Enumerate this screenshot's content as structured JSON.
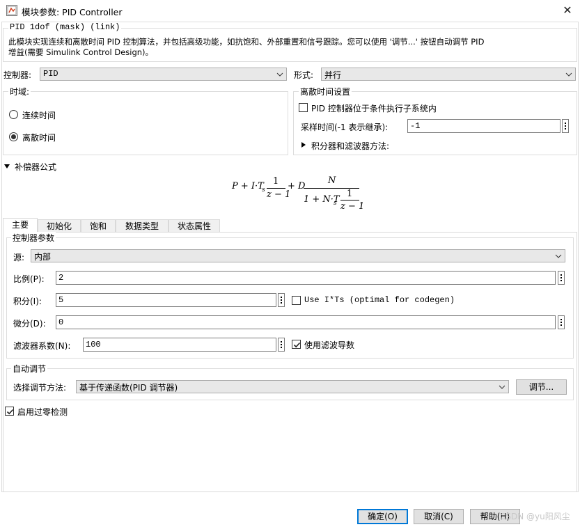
{
  "window": {
    "title": "模块参数: PID Controller"
  },
  "header": {
    "block_name": "PID 1dof (mask) (link)",
    "description_line1": "此模块实现连续和离散时间 PID 控制算法，并包括高级功能，如抗饱和、外部重置和信号跟踪。您可以使用 '调节...' 按钮自动调节 PID",
    "description_line2": "增益(需要 Simulink Control Design)。"
  },
  "controller": {
    "label": "控制器:",
    "value": "PID"
  },
  "form": {
    "label": "形式:",
    "value": "并行"
  },
  "time_domain": {
    "title": "时域:",
    "continuous_label": "连续时间",
    "discrete_label": "离散时间",
    "selected": "离散时间"
  },
  "discrete_settings": {
    "title": "离散时间设置",
    "conditional_label": "PID 控制器位于条件执行子系统内",
    "conditional_checked": false,
    "sample_time_label": "采样时间(-1 表示继承):",
    "sample_time_value": "-1",
    "integrator_methods_label": "积分器和滤波器方法:"
  },
  "compensator": {
    "label": "补偿器公式",
    "formula": {
      "lead": "P + I·T",
      "sub_s": "s",
      "num1": "1",
      "den1": "z − 1",
      "plus_d": "+ D",
      "num_N": "N",
      "den_lead": "1 + N·T",
      "num2": "1",
      "den2": "z − 1"
    }
  },
  "tabs": [
    {
      "label": "主要",
      "active": true
    },
    {
      "label": "初始化",
      "active": false
    },
    {
      "label": "饱和",
      "active": false
    },
    {
      "label": "数据类型",
      "active": false
    },
    {
      "label": "状态属性",
      "active": false
    }
  ],
  "controller_params": {
    "title": "控制器参数",
    "source_label": "源:",
    "source_value": "内部",
    "proportional_label": "比例(P):",
    "proportional_value": "2",
    "integral_label": "积分(I):",
    "integral_value": "5",
    "use_its_label": "Use I*Ts (optimal for codegen)",
    "use_its_checked": false,
    "derivative_label": "微分(D):",
    "derivative_value": "0",
    "filter_label": "滤波器系数(N):",
    "filter_value": "100",
    "use_filter_label": "使用滤波导数",
    "use_filter_checked": true
  },
  "autotune": {
    "title": "自动调节",
    "method_label": "选择调节方法:",
    "method_value": "基于传递函数(PID 调节器)",
    "tune_button": "调节..."
  },
  "zero_crossing": {
    "label": "启用过零检测",
    "checked": true
  },
  "footer": {
    "ok": "确定(O)",
    "cancel": "取消(C)",
    "help": "帮助(H)",
    "watermark": "CSDN @yu阳风尘"
  },
  "colors": {
    "accent": "#0078d7",
    "combo_bg": "#e8e8e8",
    "button_bg": "#e1e1e1"
  }
}
